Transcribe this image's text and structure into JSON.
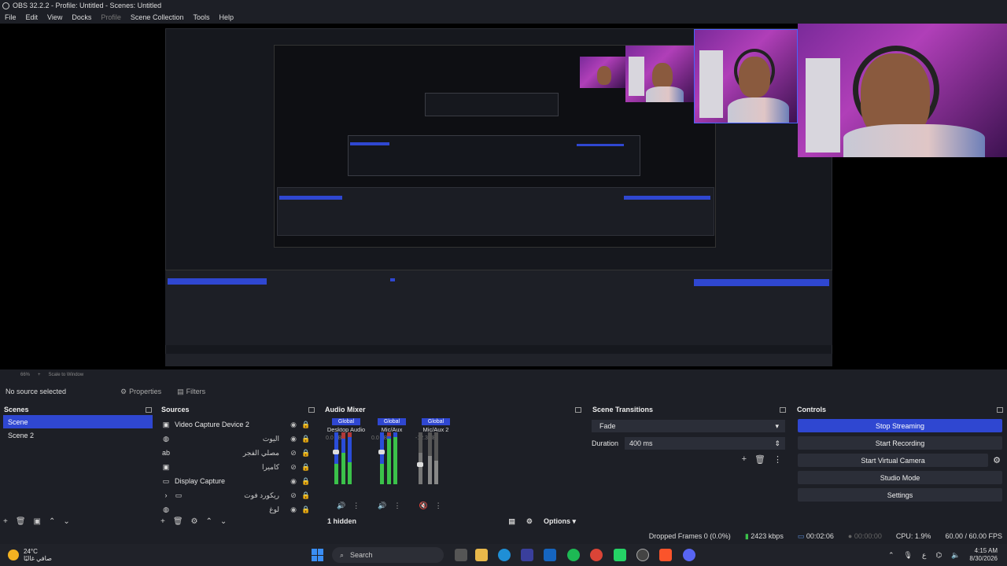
{
  "window": {
    "title": "OBS 32.2.2 - Profile: Untitled - Scenes: Untitled"
  },
  "menu": {
    "items": [
      "File",
      "Edit",
      "View",
      "Docks",
      "Profile",
      "Scene Collection",
      "Tools",
      "Help"
    ]
  },
  "source_bar": {
    "no_source": "No source selected",
    "properties": "Properties",
    "filters": "Filters"
  },
  "scenes": {
    "title": "Scenes",
    "items": [
      {
        "label": "Scene"
      },
      {
        "label": "Scene 2"
      }
    ]
  },
  "sources": {
    "title": "Sources",
    "items": [
      {
        "label": "Video Capture Device 2",
        "icon": "camera-icon"
      },
      {
        "label": "اليوت",
        "icon": "browser-icon"
      },
      {
        "label": "مصلي الفجر",
        "icon": "text-icon"
      },
      {
        "label": "كاميرا",
        "icon": "camera-icon"
      },
      {
        "label": "Display Capture",
        "icon": "monitor-icon"
      },
      {
        "label": "ريكورد فوت",
        "icon": "folder-icon"
      },
      {
        "label": "لوغ",
        "icon": "browser-icon"
      }
    ]
  },
  "mixer": {
    "title": "Audio Mixer",
    "global_label": "Global",
    "channels": [
      {
        "name": "Desktop Audio",
        "db": "0.0 dB"
      },
      {
        "name": "Mic/Aux",
        "db": "0.0 dB"
      },
      {
        "name": "Mic/Aux 2",
        "db": "-12.3 dB"
      }
    ],
    "hidden": "1 hidden",
    "options": "Options"
  },
  "transitions": {
    "title": "Scene Transitions",
    "selected": "Fade",
    "duration_label": "Duration",
    "duration_value": "400 ms"
  },
  "controls": {
    "title": "Controls",
    "stop_streaming": "Stop Streaming",
    "start_recording": "Start Recording",
    "start_virtual_camera": "Start Virtual Camera",
    "studio_mode": "Studio Mode",
    "settings": "Settings"
  },
  "preview_zoom": {
    "zoom": "66%",
    "scale": "Scale to Window"
  },
  "status": {
    "dropped": "Dropped Frames 0 (0.0%)",
    "bitrate": "2423 kbps",
    "stream_time": "00:02:06",
    "rec_time": "00:00:00",
    "cpu": "CPU: 1.9%",
    "fps": "60.00 / 60.00 FPS"
  },
  "taskbar": {
    "temp": "24°C",
    "weather_text": "صافي غالبًا",
    "search": "Search",
    "time": "4:15 AM",
    "date": "8/30/2026",
    "lang": "ع"
  },
  "colors": {
    "accent": "#2f47d1",
    "bg": "#1d1f26",
    "meter_green": "#3bc14a",
    "meter_blue": "#2a4dd8"
  }
}
